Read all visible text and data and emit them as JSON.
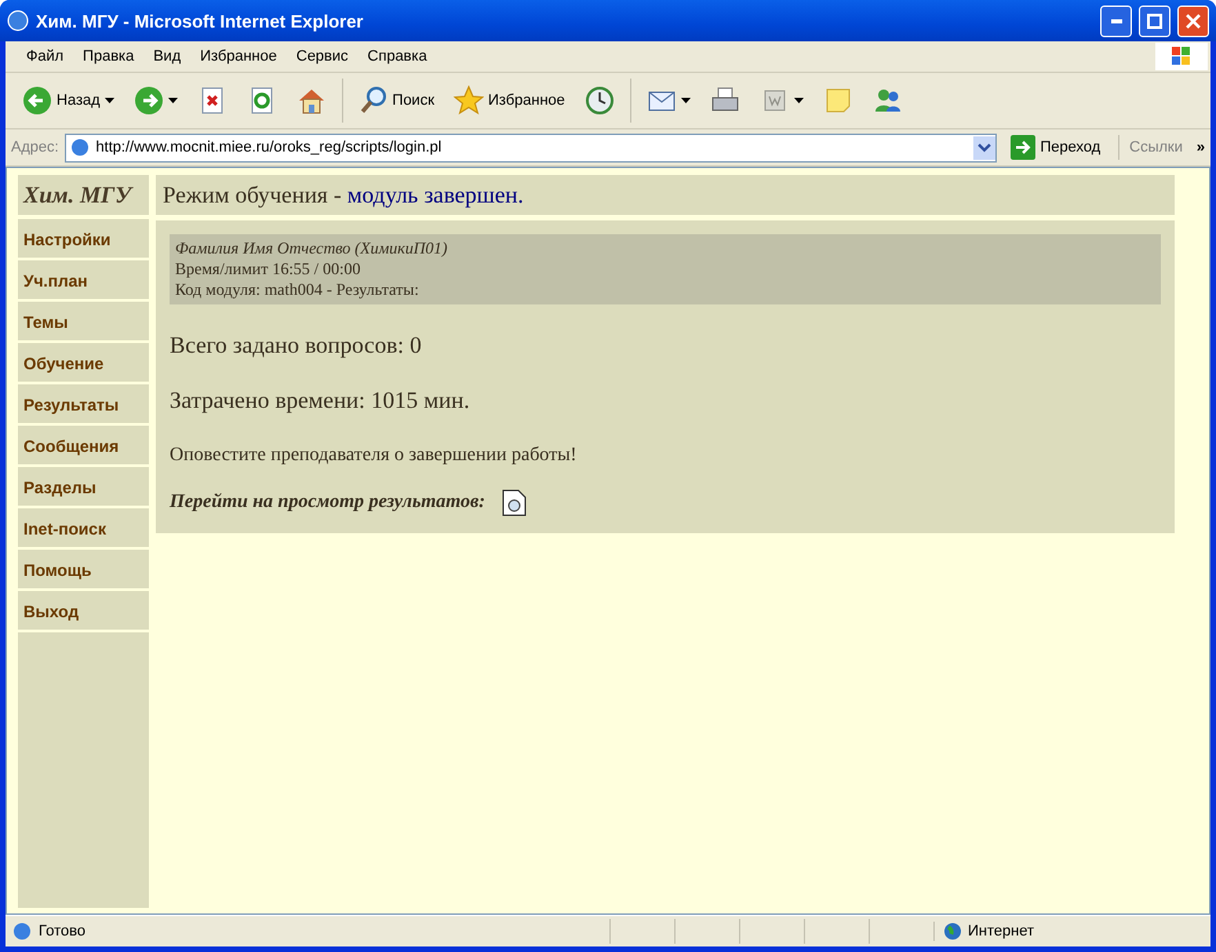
{
  "window": {
    "title": "Хим. МГУ - Microsoft Internet Explorer"
  },
  "menu_bar": [
    "Файл",
    "Правка",
    "Вид",
    "Избранное",
    "Сервис",
    "Справка"
  ],
  "toolbar": [
    {
      "kind": "back",
      "label": "Назад",
      "dropdown": true
    },
    {
      "kind": "forward",
      "dropdown": true
    },
    {
      "kind": "stop"
    },
    {
      "kind": "refresh"
    },
    {
      "kind": "home"
    },
    {
      "kind": "separator"
    },
    {
      "kind": "search",
      "label": "Поиск"
    },
    {
      "kind": "favorites",
      "label": "Избранное"
    },
    {
      "kind": "history"
    },
    {
      "kind": "separator"
    },
    {
      "kind": "mail",
      "dropdown": true
    },
    {
      "kind": "print"
    },
    {
      "kind": "edit",
      "dropdown": true
    },
    {
      "kind": "note"
    },
    {
      "kind": "messenger"
    }
  ],
  "address_bar": {
    "label": "Адрес:",
    "value": "http://www.mocnit.miee.ru/oroks_reg/scripts/login.pl",
    "go": "Переход",
    "links": "Ссылки",
    "chevron": "»"
  },
  "sidebar": {
    "title": "Хим. МГУ",
    "items": [
      "Настройки",
      "Уч.план",
      "Темы",
      "Обучение",
      "Результаты",
      "Сообщения",
      "Разделы",
      "Inet-поиск",
      "Помощь",
      "Выход"
    ]
  },
  "main": {
    "header_text": "Режим обучения - ",
    "header_link": "модуль завершен.",
    "info": {
      "name": "Фамилия Имя Отчество (ХимикиП01)",
      "time": "Время/лимит 16:55 / 00:00",
      "module": "Код модуля: math004 - Результаты:"
    },
    "total_questions": "Всего задано вопросов: 0",
    "time_spent": "Затрачено времени: 1015 мин.",
    "notice": "Оповестите преподавателя о завершении работы!",
    "results_link": "Перейти на просмотр результатов:"
  },
  "status_bar": {
    "text": "Готово",
    "zone": "Интернет"
  }
}
